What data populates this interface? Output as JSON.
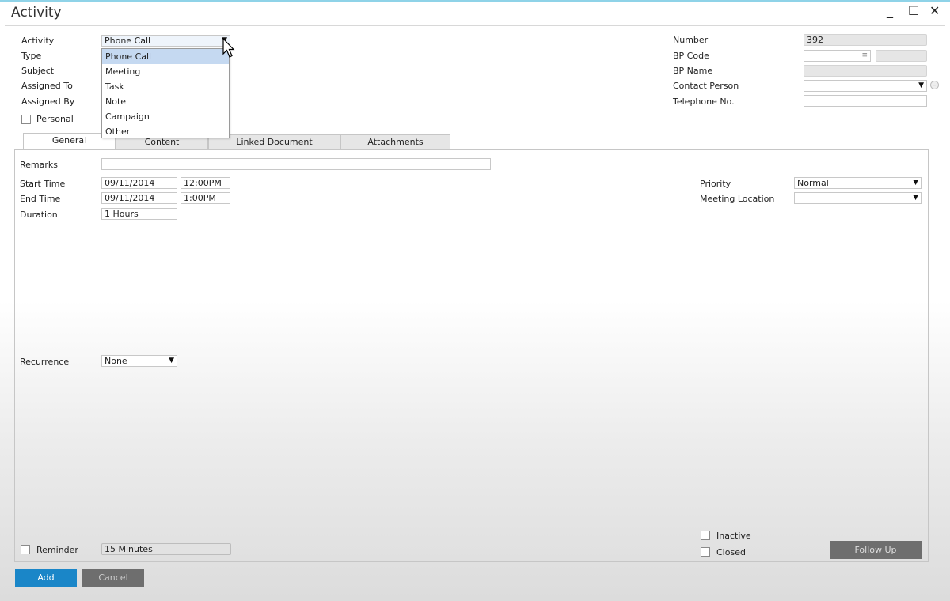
{
  "window": {
    "title": "Activity",
    "controls": {
      "minimize": "_",
      "maximize": "☐",
      "close": "✕"
    }
  },
  "header_left": {
    "activity_label": "Activity",
    "activity_value": "Phone Call",
    "type_label": "Type",
    "subject_label": "Subject",
    "assigned_to_label": "Assigned To",
    "assigned_by_label": "Assigned By",
    "personal_label": "Personal",
    "personal_checked": false
  },
  "activity_dropdown": {
    "options": [
      "Phone Call",
      "Meeting",
      "Task",
      "Note",
      "Campaign",
      "Other"
    ],
    "selected": "Phone Call"
  },
  "header_right": {
    "number_label": "Number",
    "number_value": "392",
    "bp_code_label": "BP Code",
    "bp_code_value": "",
    "bp_name_label": "BP Name",
    "bp_name_value": "",
    "contact_person_label": "Contact Person",
    "contact_person_value": "",
    "telephone_label": "Telephone No.",
    "telephone_value": ""
  },
  "tabs": [
    {
      "label": "General",
      "active": true
    },
    {
      "label": "Content",
      "active": false
    },
    {
      "label": "Linked Document",
      "active": false
    },
    {
      "label": "Attachments",
      "active": false
    }
  ],
  "general": {
    "remarks_label": "Remarks",
    "remarks_value": "",
    "start_time_label": "Start Time",
    "start_date": "09/11/2014",
    "start_time": "12:00PM",
    "end_time_label": "End Time",
    "end_date": "09/11/2014",
    "end_time": "1:00PM",
    "duration_label": "Duration",
    "duration_value": "1 Hours",
    "priority_label": "Priority",
    "priority_value": "Normal",
    "meeting_location_label": "Meeting Location",
    "meeting_location_value": "",
    "recurrence_label": "Recurrence",
    "recurrence_value": "None",
    "reminder_label": "Reminder",
    "reminder_checked": false,
    "reminder_value": "15 Minutes",
    "inactive_label": "Inactive",
    "inactive_checked": false,
    "closed_label": "Closed",
    "closed_checked": false,
    "follow_up_label": "Follow Up"
  },
  "footer": {
    "add_label": "Add",
    "cancel_label": "Cancel"
  },
  "colors": {
    "primary_button": "#1a86c8",
    "secondary_button": "#6e6e6e",
    "dropdown_highlight": "#c5d9f1"
  }
}
